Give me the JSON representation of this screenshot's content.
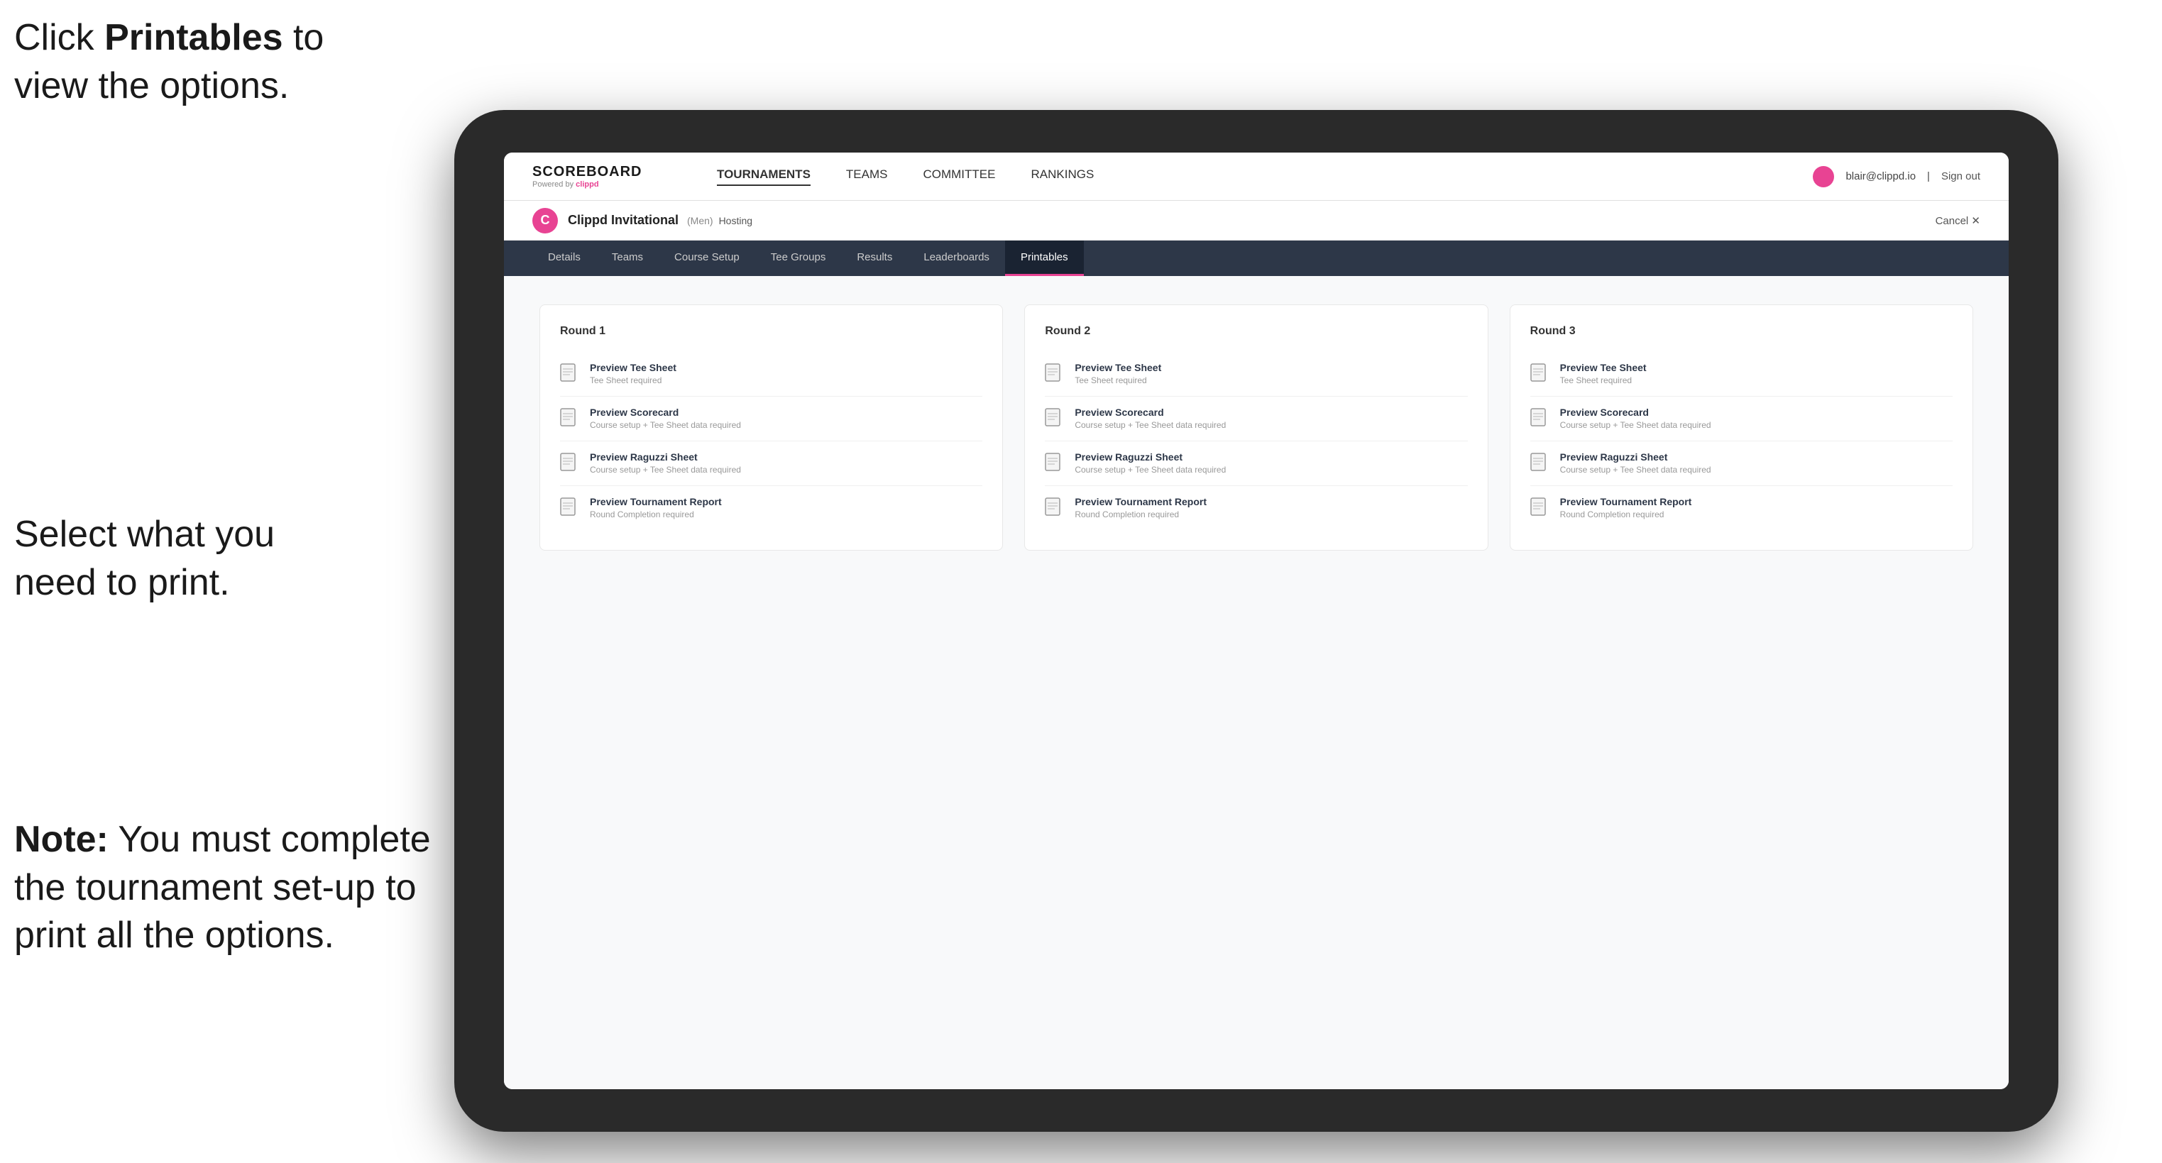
{
  "instructions": {
    "top_line1": "Click ",
    "top_bold": "Printables",
    "top_line2": " to",
    "top_line3": "view the options.",
    "middle_line1": "Select what you",
    "middle_line2": "need to print.",
    "bottom_bold": "Note:",
    "bottom_text": " You must complete the tournament set-up to print all the options."
  },
  "nav": {
    "brand": "SCOREBOARD",
    "brand_sub": "Powered by clippd",
    "links": [
      "TOURNAMENTS",
      "TEAMS",
      "COMMITTEE",
      "RANKINGS"
    ],
    "user_email": "blair@clippd.io",
    "sign_out": "Sign out"
  },
  "tournament": {
    "name": "Clippd Invitational",
    "tag": "(Men)",
    "status": "Hosting",
    "cancel": "Cancel ✕"
  },
  "tabs": [
    "Details",
    "Teams",
    "Course Setup",
    "Tee Groups",
    "Results",
    "Leaderboards",
    "Printables"
  ],
  "active_tab": "Printables",
  "rounds": [
    {
      "title": "Round 1",
      "items": [
        {
          "title": "Preview Tee Sheet",
          "subtitle": "Tee Sheet required"
        },
        {
          "title": "Preview Scorecard",
          "subtitle": "Course setup + Tee Sheet data required"
        },
        {
          "title": "Preview Raguzzi Sheet",
          "subtitle": "Course setup + Tee Sheet data required"
        },
        {
          "title": "Preview Tournament Report",
          "subtitle": "Round Completion required"
        }
      ]
    },
    {
      "title": "Round 2",
      "items": [
        {
          "title": "Preview Tee Sheet",
          "subtitle": "Tee Sheet required"
        },
        {
          "title": "Preview Scorecard",
          "subtitle": "Course setup + Tee Sheet data required"
        },
        {
          "title": "Preview Raguzzi Sheet",
          "subtitle": "Course setup + Tee Sheet data required"
        },
        {
          "title": "Preview Tournament Report",
          "subtitle": "Round Completion required"
        }
      ]
    },
    {
      "title": "Round 3",
      "items": [
        {
          "title": "Preview Tee Sheet",
          "subtitle": "Tee Sheet required"
        },
        {
          "title": "Preview Scorecard",
          "subtitle": "Course setup + Tee Sheet data required"
        },
        {
          "title": "Preview Raguzzi Sheet",
          "subtitle": "Course setup + Tee Sheet data required"
        },
        {
          "title": "Preview Tournament Report",
          "subtitle": "Round Completion required"
        }
      ]
    }
  ]
}
